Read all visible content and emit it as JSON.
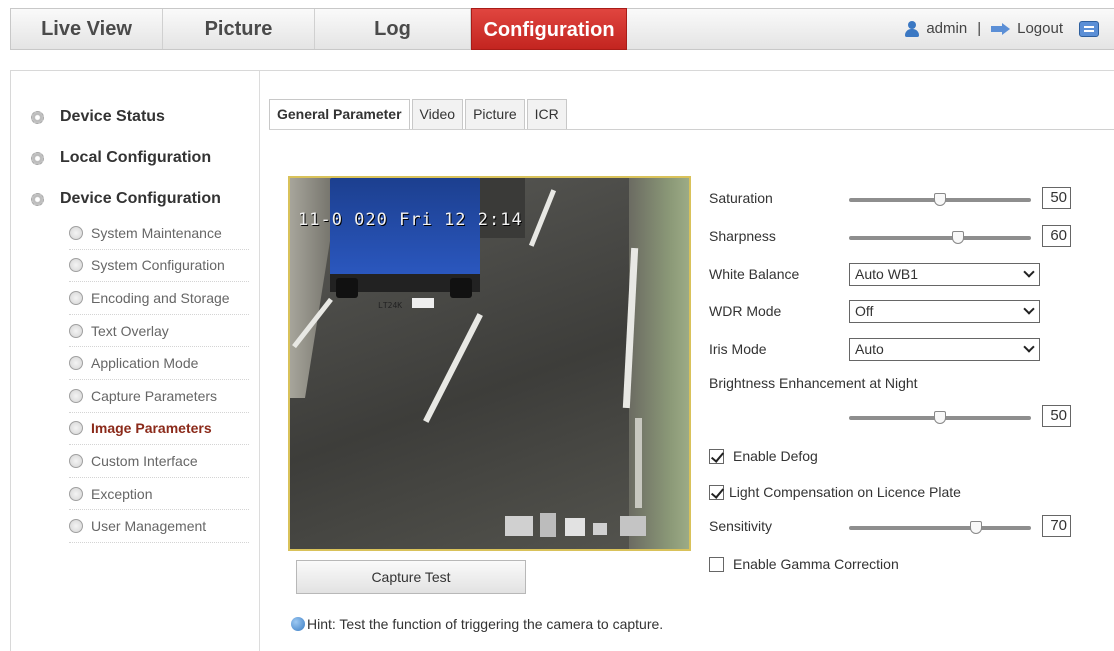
{
  "topnav": {
    "tabs": [
      {
        "label": "Live View"
      },
      {
        "label": "Picture"
      },
      {
        "label": "Log"
      },
      {
        "label": "Configuration",
        "active": true
      }
    ],
    "user": "admin",
    "separator": "|",
    "logout": "Logout"
  },
  "sidebar": {
    "groups": [
      "Device Status",
      "Local Configuration",
      "Device Configuration"
    ],
    "items": [
      {
        "label": "System Maintenance"
      },
      {
        "label": "System Configuration"
      },
      {
        "label": "Encoding and Storage"
      },
      {
        "label": "Text Overlay"
      },
      {
        "label": "Application Mode"
      },
      {
        "label": "Capture Parameters"
      },
      {
        "label": "Image Parameters",
        "active": true
      },
      {
        "label": "Custom Interface"
      },
      {
        "label": "Exception"
      },
      {
        "label": "User Management"
      }
    ]
  },
  "tabs": [
    {
      "label": "General Parameter",
      "active": true
    },
    {
      "label": "Video"
    },
    {
      "label": "Picture"
    },
    {
      "label": "ICR"
    }
  ],
  "preview": {
    "osd_text": "11-0 020 Fri 12 2:14",
    "plate_text": "LT24K"
  },
  "capture_button": "Capture Test",
  "hint": "Hint: Test the function of triggering the camera to capture.",
  "params": {
    "saturation": {
      "label": "Saturation",
      "value": "50",
      "level": 0.5
    },
    "sharpness": {
      "label": "Sharpness",
      "value": "60",
      "level": 0.6
    },
    "white_balance": {
      "label": "White Balance",
      "value": "Auto WB1"
    },
    "wdr_mode": {
      "label": "WDR Mode",
      "value": "Off"
    },
    "iris_mode": {
      "label": "Iris Mode",
      "value": "Auto"
    },
    "brightness_night": {
      "label": "Brightness Enhancement at Night",
      "value": "50",
      "level": 0.5
    },
    "enable_defog": {
      "label": "Enable Defog",
      "checked": true
    },
    "light_compensation": {
      "label": "Light Compensation on Licence Plate",
      "checked": true
    },
    "sensitivity": {
      "label": "Sensitivity",
      "value": "70",
      "level": 0.7
    },
    "gamma": {
      "label": "Enable Gamma Correction",
      "checked": false
    }
  },
  "colors": {
    "active_tab": "#c32520",
    "active_menu": "#8b2a1a",
    "preview_border": "#d9c25a"
  }
}
